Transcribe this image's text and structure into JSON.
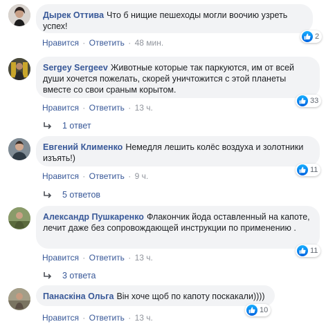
{
  "actions": {
    "like": "Нравится",
    "reply": "Ответить",
    "separator": "·"
  },
  "colors": {
    "author": "#385898",
    "bubble": "#f2f3f5",
    "like": "#1877f2"
  },
  "comments": [
    {
      "author": "Дырек Оттива",
      "text": "Что б нищие пешеходы могли воочию узреть успех!",
      "likes": "2",
      "time": "48 мин.",
      "replies": ""
    },
    {
      "author": "Sergey Sergeev",
      "text": "Животные которые так паркуются, им от всей души хочется пожелать, скорей уничтожится с этой планеты вместе со свои сраным корытом.",
      "likes": "33",
      "time": "13 ч.",
      "replies": "1 ответ"
    },
    {
      "author": "Евгений Клименко",
      "text": "Немедля лешить колёс воздуха и золотники изъять!)",
      "likes": "11",
      "time": "9 ч.",
      "replies": "5 ответов"
    },
    {
      "author": "Александр Пушкаренко",
      "text": "Флакончик йода оставленный на капоте, лечит даже без сопровождающей инструкции по применению .",
      "likes": "11",
      "time": "13 ч.",
      "replies": "3 ответа"
    },
    {
      "author": "Панаскіна Ольга",
      "text": "Він хоче щоб по капоту поскакали))))",
      "likes": "10",
      "time": "13 ч.",
      "replies": ""
    }
  ]
}
